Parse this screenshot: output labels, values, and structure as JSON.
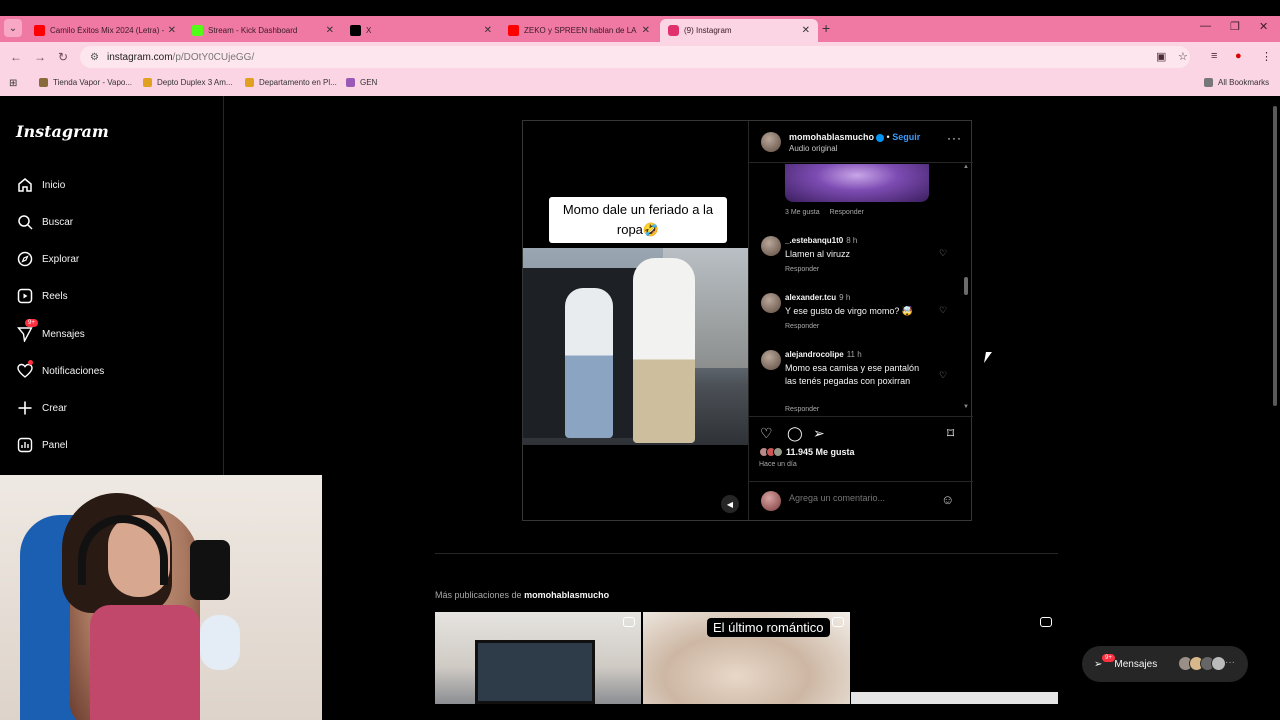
{
  "browser": {
    "tabs": [
      {
        "label": "Camilo Éxitos Mix 2024 (Letra) -",
        "favicon_color": "#ff0000",
        "active": false
      },
      {
        "label": "Stream - Kick Dashboard",
        "favicon_color": "#53fc18",
        "active": false
      },
      {
        "label": "X",
        "favicon_color": "#000000",
        "active": false
      },
      {
        "label": "ZEKO y SPREEN hablan de LA Vi",
        "favicon_color": "#ff0000",
        "active": false
      },
      {
        "label": "(9) Instagram",
        "favicon_color": "#e1306c",
        "active": true
      }
    ],
    "url_host": "instagram.com",
    "url_path": "/p/DOtY0CUjeGG/",
    "bookmarks": [
      {
        "label": "Tienda Vapor - Vapo..."
      },
      {
        "label": "Depto Duplex 3 Am..."
      },
      {
        "label": "Departamento en Pl..."
      },
      {
        "label": "GEN"
      }
    ],
    "all_bookmarks": "All Bookmarks"
  },
  "sidebar": {
    "logo": "Instagram",
    "items": [
      {
        "label": "Inicio",
        "icon": "home-icon"
      },
      {
        "label": "Buscar",
        "icon": "search-icon"
      },
      {
        "label": "Explorar",
        "icon": "compass-icon"
      },
      {
        "label": "Reels",
        "icon": "reels-icon"
      },
      {
        "label": "Mensajes",
        "icon": "messenger-icon",
        "badge": "9+"
      },
      {
        "label": "Notificaciones",
        "icon": "heart-icon"
      },
      {
        "label": "Crear",
        "icon": "plus-icon"
      },
      {
        "label": "Panel",
        "icon": "dashboard-icon"
      }
    ]
  },
  "post": {
    "caption_overlay": "Momo dale un feriado a la ropa🤣",
    "username": "momohablasmucho",
    "separator": "•",
    "follow": "Seguir",
    "audio": "Audio original",
    "prev_comment_meta": {
      "likes": "3 Me gusta",
      "reply": "Responder"
    },
    "comments": [
      {
        "user": "_.estebanqu1t0",
        "time": "8 h",
        "text": "Llamen al viruzz",
        "reply": "Responder"
      },
      {
        "user": "alexander.tcu",
        "time": "9 h",
        "text": "Y ese gusto de virgo momo? 🤯",
        "reply": "Responder"
      },
      {
        "user": "alejandrocolipe",
        "time": "11 h",
        "text": "Momo esa camisa y ese pantalón las tenés pegadas con poxirran",
        "reply": "Responder"
      }
    ],
    "likes": "11.945 Me gusta",
    "time_ago": "Hace un día",
    "comment_placeholder": "Agrega un comentario..."
  },
  "more_posts": {
    "prefix": "Más publicaciones de ",
    "user": "momohablasmucho",
    "items": [
      {
        "caption": ""
      },
      {
        "caption": "El último romántico"
      },
      {
        "caption": ""
      }
    ]
  },
  "messages_button": {
    "label": "Mensajes",
    "badge": "9+"
  }
}
